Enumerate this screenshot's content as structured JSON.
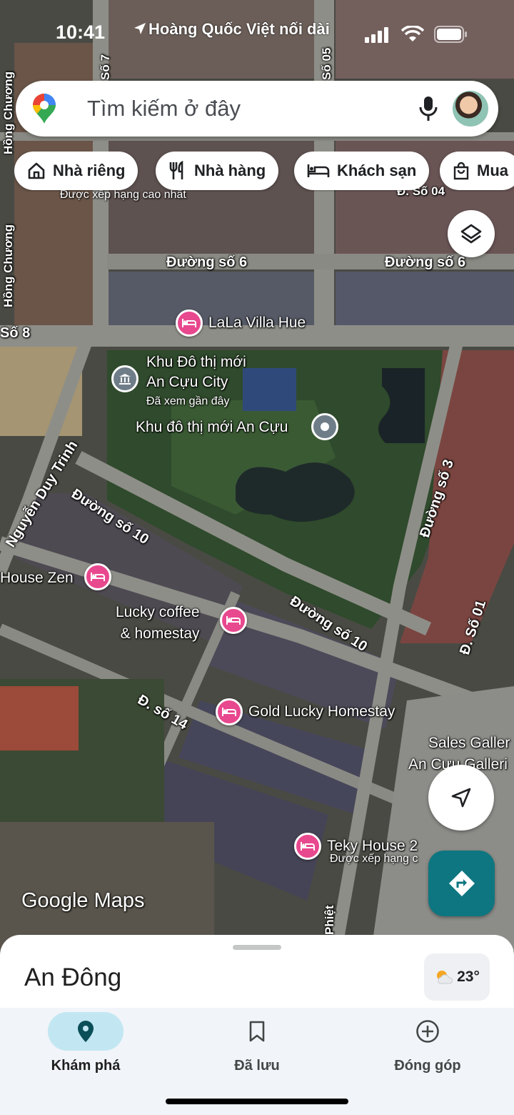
{
  "status_bar": {
    "time": "10:41",
    "back_app": "Hoàng Quốc Việt nối dài"
  },
  "search": {
    "placeholder": "Tìm kiếm ở đây"
  },
  "chips": [
    {
      "label": "Nhà riêng",
      "icon": "home-icon"
    },
    {
      "label": "Nhà hàng",
      "icon": "restaurant-icon"
    },
    {
      "label": "Khách sạn",
      "icon": "hotel-icon"
    },
    {
      "label": "Mua",
      "icon": "shopping-bag-icon"
    }
  ],
  "map": {
    "roads": {
      "duong_so_6_left": "Đường số 6",
      "duong_so_6_right": "Đường số 6",
      "duong_so_10_left": "Đường số 10",
      "duong_so_10_right": "Đường số 10",
      "duong_so_3": "Đường số 3",
      "d_so_14": "Đ. số 14",
      "d_so_01": "Đ. Số 01",
      "d_so_04": "Đ. Số 04",
      "so_8": "Số 8",
      "so_7": "Số 7",
      "so_05": "Số 05",
      "hong_chuong_top": "Hồng Chương",
      "hong_chuong_mid": "Hồng Chương",
      "nguyen_duy_trinh": "Nguyễn Duy Trinh",
      "phiet": "Phiệt"
    },
    "places": {
      "top_poi_subtitle": "Được xếp hạng cao nhất",
      "lala_villa": "LaLa Villa Hue",
      "an_cuu_city": "Khu Đô thị mới\nAn Cựu City",
      "an_cuu_city_sub": "Đã xem gần đây",
      "an_cuu_urban": "Khu đô thị mới An Cựu",
      "house_zen": "House Zen",
      "lucky_coffee": "Lucky coffee\n& homestay",
      "gold_lucky": "Gold Lucky Homestay",
      "teky_house": "Teky House 2",
      "teky_sub": "Được xếp hạng c",
      "sales_gallery": "Sales Galler",
      "an_cuu_gallery": "An Cựu Galleri"
    },
    "watermark": "Google Maps"
  },
  "sheet": {
    "area_name": "An Đông",
    "temperature": "23°"
  },
  "tabs": [
    {
      "label": "Khám phá",
      "icon": "explore-pin-icon",
      "active": true
    },
    {
      "label": "Đã lưu",
      "icon": "bookmark-icon",
      "active": false
    },
    {
      "label": "Đóng góp",
      "icon": "add-circle-icon",
      "active": false
    }
  ]
}
